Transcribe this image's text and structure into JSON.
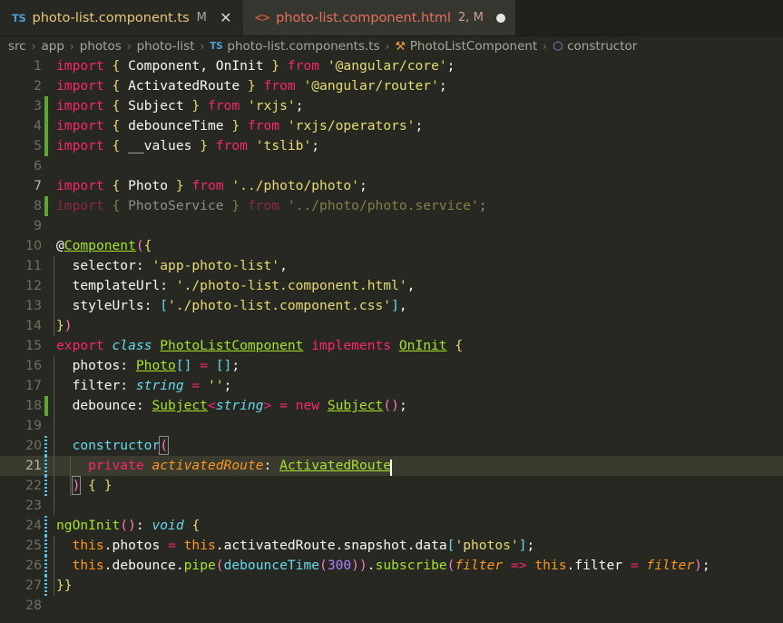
{
  "window": {
    "app": "code-editor"
  },
  "tabs": [
    {
      "icon": "TS",
      "icon_name": "typescript-file-icon",
      "label": "photo-list.component.ts",
      "badge": "M",
      "close": "✕",
      "active": true,
      "dirty": false
    },
    {
      "icon": "<>",
      "icon_name": "html-file-icon",
      "label": "photo-list.component.html",
      "badge": "2, M",
      "close": "",
      "active": false,
      "dirty": true
    }
  ],
  "breadcrumb": [
    {
      "label": "src",
      "icon": ""
    },
    {
      "label": "app",
      "icon": ""
    },
    {
      "label": "photos",
      "icon": ""
    },
    {
      "label": "photo-list",
      "icon": ""
    },
    {
      "label": "photo-list.components.ts",
      "icon": "TS",
      "icon_kind": "ts"
    },
    {
      "label": "PhotoListComponent",
      "icon": "⚒",
      "icon_kind": "class"
    },
    {
      "label": "constructor",
      "icon": "⬡",
      "icon_kind": "method"
    }
  ],
  "breadcrumb_separator": "›",
  "editor": {
    "language": "typescript",
    "current_line": 21,
    "total_lines": 28,
    "line_numbers": [
      1,
      2,
      3,
      4,
      5,
      6,
      7,
      8,
      9,
      10,
      11,
      12,
      13,
      14,
      15,
      16,
      17,
      18,
      19,
      20,
      21,
      22,
      23,
      24,
      25,
      26,
      27,
      28
    ],
    "lines": [
      {
        "n": 1,
        "text": "import { Component, OnInit } from '@angular/core';"
      },
      {
        "n": 2,
        "text": "import { ActivatedRoute } from '@angular/router';"
      },
      {
        "n": 3,
        "text": "import { Subject } from 'rxjs';",
        "gutter": "added"
      },
      {
        "n": 4,
        "text": "import { debounceTime } from 'rxjs/operators';",
        "gutter": "added"
      },
      {
        "n": 5,
        "text": "import { __values } from 'tslib';",
        "gutter": "added"
      },
      {
        "n": 6,
        "text": ""
      },
      {
        "n": 7,
        "text": "import { Photo } from '../photo/photo';"
      },
      {
        "n": 8,
        "text": "import { PhotoService } from '../photo/photo.service';",
        "gutter": "added",
        "dim": true
      },
      {
        "n": 9,
        "text": ""
      },
      {
        "n": 10,
        "text": "@Component({"
      },
      {
        "n": 11,
        "text": "  selector: 'app-photo-list',"
      },
      {
        "n": 12,
        "text": "  templateUrl: './photo-list.component.html',"
      },
      {
        "n": 13,
        "text": "  styleUrls: ['./photo-list.component.css'],"
      },
      {
        "n": 14,
        "text": "})"
      },
      {
        "n": 15,
        "text": "export class PhotoListComponent implements OnInit {"
      },
      {
        "n": 16,
        "text": "  photos: Photo[] = [];"
      },
      {
        "n": 17,
        "text": "  filter: string = '';"
      },
      {
        "n": 18,
        "text": "  debounce: Subject<string> = new Subject();",
        "gutter": "added"
      },
      {
        "n": 19,
        "text": ""
      },
      {
        "n": 20,
        "text": "  constructor(",
        "gutter": "dashed"
      },
      {
        "n": 21,
        "text": "    private activatedRoute: ActivatedRoute",
        "gutter": "dashed",
        "current": true
      },
      {
        "n": 22,
        "text": "  ) { }",
        "gutter": "dashed"
      },
      {
        "n": 23,
        "text": ""
      },
      {
        "n": 24,
        "text": "ngOnInit(): void {",
        "gutter": "dashed"
      },
      {
        "n": 25,
        "text": "  this.photos = this.activatedRoute.snapshot.data['photos'];",
        "gutter": "dashed"
      },
      {
        "n": 26,
        "text": "  this.debounce.pipe(debounceTime(300)).subscribe(filter => this.filter = filter);",
        "gutter": "dashed"
      },
      {
        "n": 27,
        "text": "}}",
        "gutter": "dashed"
      },
      {
        "n": 28,
        "text": ""
      }
    ],
    "cursor": {
      "line": 21,
      "column": 35
    }
  },
  "colors": {
    "editor_background": "#272822",
    "tabbar_background": "#1f211c",
    "inactive_tab_background": "#34362f",
    "current_line_background": "#3a3a2f",
    "keyword": "#f92672",
    "string": "#e6db74",
    "class_name": "#a6e22e",
    "type": "#66d9ef",
    "number": "#ae81ff",
    "parameter": "#fd971f",
    "plain_text": "#f8f8f2",
    "line_number": "#6f7066",
    "git_added": "#5aa832",
    "gutter_dashed": "#4fc1e8",
    "active_tab_label": "#e8c77a",
    "inactive_tab_label": "#e8705a",
    "ts_icon": "#4d9ed8",
    "html_icon": "#e8622c",
    "class_icon": "#e39b4a",
    "method_icon": "#b07fd4"
  }
}
